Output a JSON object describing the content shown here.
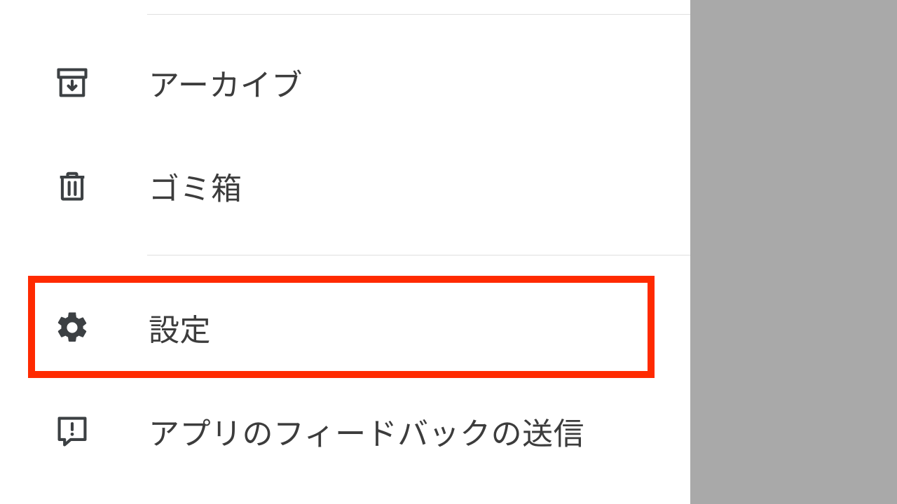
{
  "sidebar": {
    "items": [
      {
        "icon": "archive-icon",
        "label": "アーカイブ"
      },
      {
        "icon": "trash-icon",
        "label": "ゴミ箱"
      },
      {
        "icon": "gear-icon",
        "label": "設定"
      },
      {
        "icon": "feedback-icon",
        "label": "アプリのフィードバックの送信"
      }
    ]
  },
  "highlighted_index": 2,
  "colors": {
    "highlight": "#ff2a00",
    "icon": "#3c4043",
    "text": "#3c3c3c"
  }
}
